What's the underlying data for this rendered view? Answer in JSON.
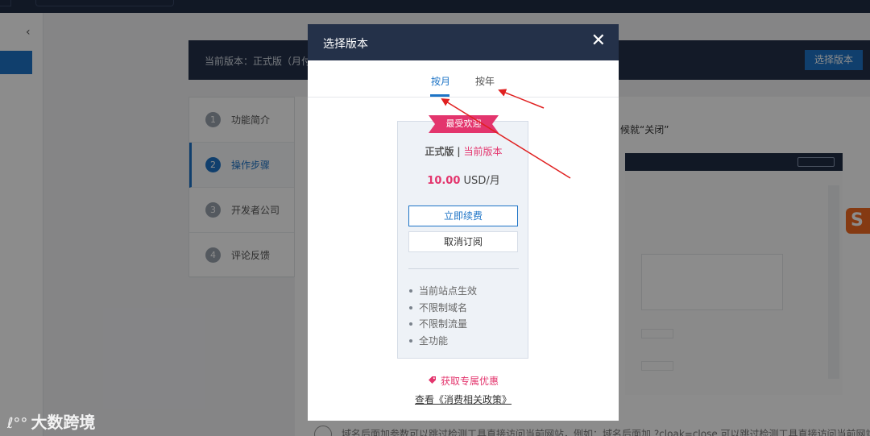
{
  "background": {
    "banner": {
      "current_version": "当前版本：正式版（月付",
      "select_version_button": "选择版本"
    },
    "steps": [
      {
        "num": "1",
        "label": "功能简介"
      },
      {
        "num": "2",
        "label": "操作步骤"
      },
      {
        "num": "3",
        "label": "开发者公司"
      },
      {
        "num": "4",
        "label": "评论反馈"
      }
    ],
    "hint_text": "候就“关闭”",
    "bottom_text": "域名后面加参数可以跳过检测工具直接访问当前网站，例如：域名后面加 ?cloak=close 可以跳过检测工具直接访问当前网站"
  },
  "modal": {
    "title": "选择版本",
    "close_glyph": "✕",
    "tabs": {
      "monthly": "按月",
      "yearly": "按年"
    },
    "plan": {
      "ribbon": "最受欢迎",
      "name": "正式版",
      "separator": "|",
      "current": "当前版本",
      "price_amount": "10.00",
      "price_unit": "USD/月",
      "renew_button": "立即续费",
      "cancel_button": "取消订阅",
      "features": [
        "当前站点生效",
        "不限制域名",
        "不限制流量",
        "全功能"
      ]
    },
    "promo_link": "获取专属优惠",
    "policy_link": "查看《消费相关政策》"
  },
  "watermark": {
    "logo_glyph": "ℓ°°",
    "text": "大数跨境"
  },
  "colors": {
    "header_dark": "#243149",
    "accent_blue": "#1e74c6",
    "accent_pink": "#e3356d",
    "annotation_red": "#e02020"
  }
}
